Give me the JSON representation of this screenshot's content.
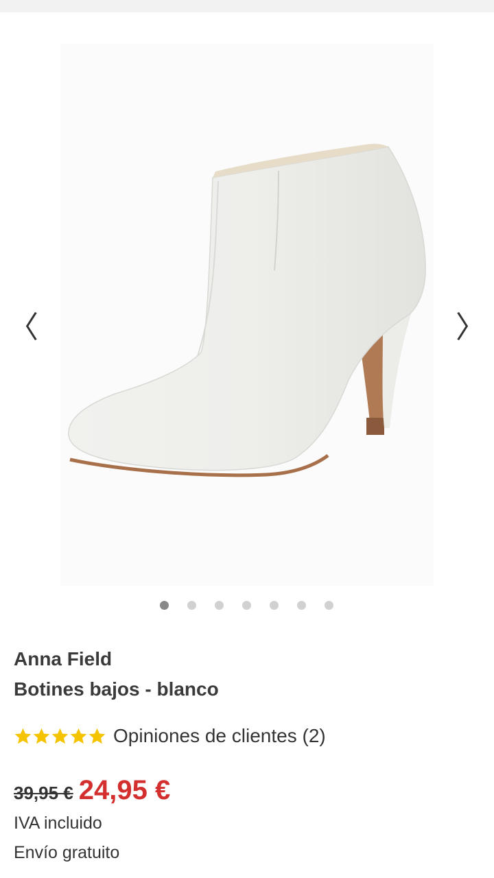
{
  "gallery": {
    "prev_symbol": "〈",
    "next_symbol": "〉",
    "image_description_icon": "white-ankle-boot-image",
    "dot_count": 7,
    "active_dot": 0
  },
  "product": {
    "brand": "Anna Field",
    "name": "Botines bajos - blanco"
  },
  "rating": {
    "stars": 5,
    "max_stars": 5,
    "reviews_label": "Opiniones de clientes (2)"
  },
  "price": {
    "old": "39,95 €",
    "current": "24,95 €",
    "vat_note": "IVA incluido",
    "shipping_note": "Envío gratuito"
  },
  "colors": {
    "sale_red": "#d32f2f",
    "star_yellow": "#f5c400",
    "dot_active": "#888888",
    "dot_inactive": "#d1d1d1"
  }
}
